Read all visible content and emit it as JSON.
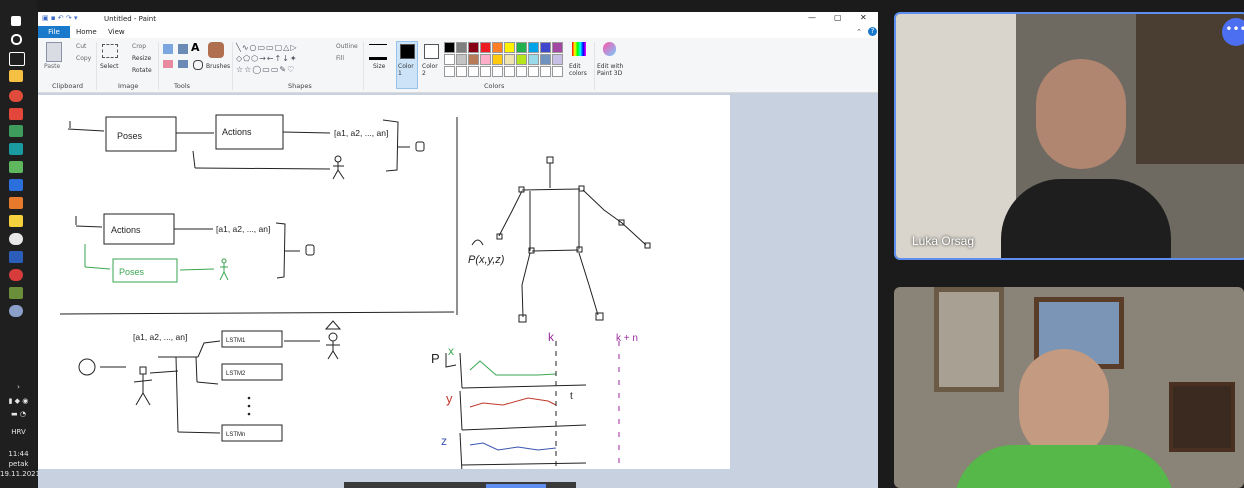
{
  "taskbar": {
    "lang": "HRV",
    "time": "11:44",
    "day": "petak",
    "date": "19.11.2021."
  },
  "paint": {
    "title": "Untitled - Paint",
    "tabs": [
      "File",
      "Home",
      "View"
    ],
    "groups": {
      "clipboard": "Clipboard",
      "image": "Image",
      "tools": "Tools",
      "shapes": "Shapes",
      "colors": "Colors"
    },
    "buttons": {
      "paste": "Paste",
      "cut": "Cut",
      "copy": "Copy",
      "select": "Select",
      "crop": "Crop",
      "resize": "Resize",
      "rotate": "Rotate",
      "brushes": "Brushes",
      "outline": "Outline",
      "fill": "Fill",
      "size": "Size",
      "color1": "Color 1",
      "color2": "Color 2",
      "edit_colors": "Edit colors",
      "edit_paint3d": "Edit with Paint 3D"
    },
    "palette_row1": [
      "#000000",
      "#7f7f7f",
      "#880015",
      "#ed1c24",
      "#ff7f27",
      "#fff200",
      "#22b14c",
      "#00a2e8",
      "#3f48cc",
      "#a349a4"
    ],
    "palette_row2": [
      "#ffffff",
      "#c3c3c3",
      "#b97a57",
      "#ffaec9",
      "#ffc90e",
      "#efe4b0",
      "#b5e61d",
      "#99d9ea",
      "#7092be",
      "#c8bfe7"
    ],
    "sketch": {
      "diagram1": {
        "poses": "Poses",
        "actions": "Actions",
        "seq": "[a1, a2, ..., an]"
      },
      "diagram2": {
        "actions": "Actions",
        "poses": "Poses",
        "seq": "[a1, a2, ..., an]"
      },
      "diagram3": {
        "seq": "[a1, a2, ..., an]",
        "lstm1": "LSTM1",
        "lstm2": "LSTM2",
        "lstmn": "LSTMn"
      },
      "plot": {
        "k": "k",
        "kn": "k + n",
        "x": "x",
        "y": "y",
        "z": "z",
        "t": "t",
        "p": "P"
      },
      "skeleton_note": "P(x,y,z)"
    }
  },
  "participants": [
    {
      "name": "Luka Orsag"
    },
    {
      "name": ""
    }
  ]
}
